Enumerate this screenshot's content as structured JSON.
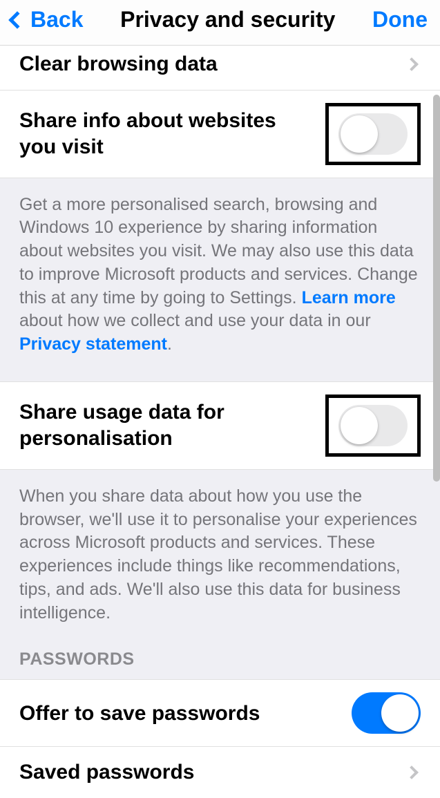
{
  "nav": {
    "back": "Back",
    "title": "Privacy and security",
    "done": "Done"
  },
  "rows": {
    "clear_data": "Clear browsing data",
    "share_sites": "Share info about websites you visit",
    "share_usage": "Share usage data for personalisation",
    "offer_save": "Offer to save passwords",
    "saved_pw": "Saved passwords"
  },
  "footers": {
    "share_sites_pre": "Get a more personalised search, browsing and Windows 10 experience by sharing information about websites you visit. We may also use this data to improve Microsoft products and services. Change this at any time by going to Settings. ",
    "learn_more": "Learn more",
    "share_sites_mid": " about how we collect and use your data in our ",
    "privacy_statement": "Privacy statement",
    "period": ".",
    "share_usage": "When you share data about how you use the browser, we'll use it to personalise your experiences across Microsoft products and services. These experiences include things like recommendations, tips, and ads. We'll also use this data for business intelligence."
  },
  "sections": {
    "passwords": "PASSWORDS"
  },
  "toggles": {
    "share_sites": false,
    "share_usage": false,
    "offer_save": true
  }
}
